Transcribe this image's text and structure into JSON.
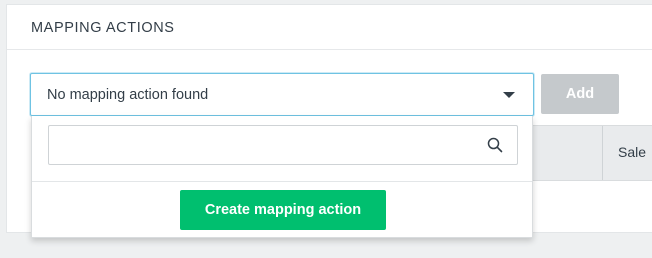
{
  "panel": {
    "title": "MAPPING ACTIONS"
  },
  "select": {
    "value": "No mapping action found",
    "icon": "caret-down-icon"
  },
  "add_button": {
    "label": "Add"
  },
  "dropdown": {
    "search": {
      "value": "",
      "placeholder": "",
      "icon": "search-icon"
    },
    "create_button": {
      "label": "Create mapping action"
    }
  },
  "table": {
    "visible_column_label": "Sale"
  },
  "colors": {
    "accent_green": "#00bf6f",
    "focus_blue": "#6fc3e3",
    "disabled_gray": "#c5c9cc",
    "text": "#333e48"
  }
}
